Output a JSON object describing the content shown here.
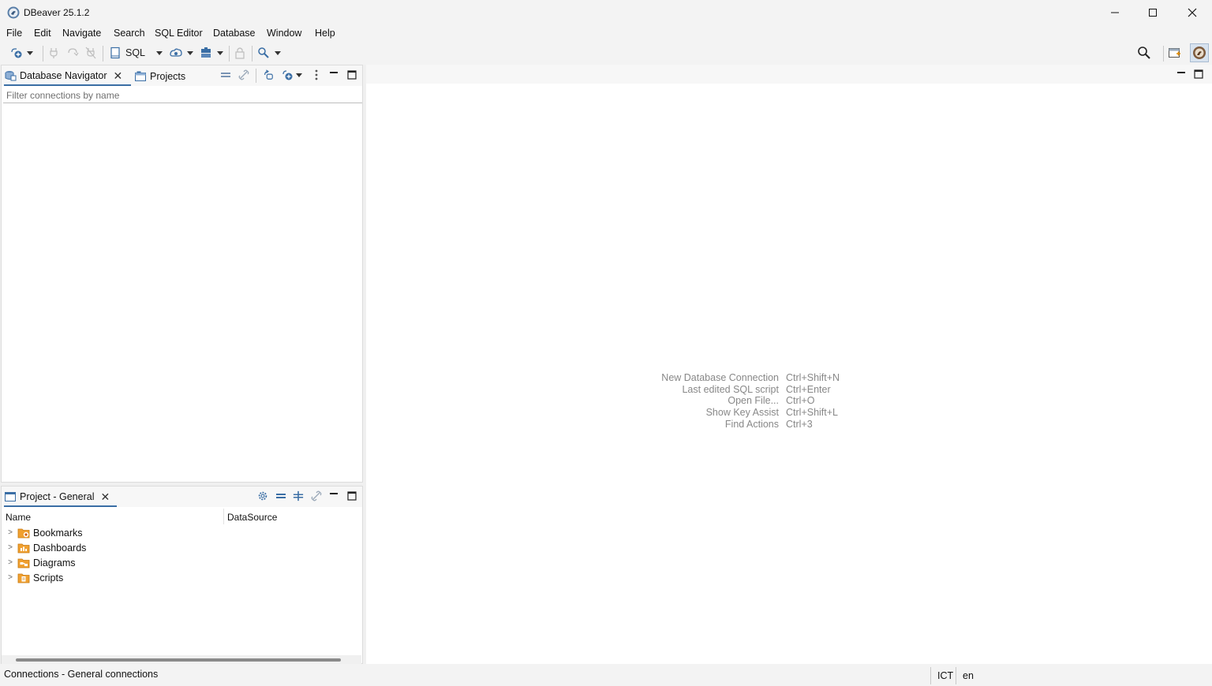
{
  "window": {
    "title": "DBeaver 25.1.2"
  },
  "menu": [
    "File",
    "Edit",
    "Navigate",
    "Search",
    "SQL Editor",
    "Database",
    "Window",
    "Help"
  ],
  "toolbar": {
    "sql_label": "SQL"
  },
  "navigator": {
    "tabs": [
      {
        "label": "Database Navigator",
        "icon": "database-navigator-icon",
        "active": true
      },
      {
        "label": "Projects",
        "icon": "projects-icon",
        "active": false
      }
    ],
    "filter_placeholder": "Filter connections by name"
  },
  "project": {
    "tab_label": "Project - General",
    "columns": [
      "Name",
      "DataSource"
    ],
    "items": [
      {
        "label": "Bookmarks",
        "icon": "bookmarks-folder-icon"
      },
      {
        "label": "Dashboards",
        "icon": "dashboards-folder-icon"
      },
      {
        "label": "Diagrams",
        "icon": "diagrams-folder-icon"
      },
      {
        "label": "Scripts",
        "icon": "scripts-folder-icon"
      }
    ]
  },
  "editor": {
    "shortcuts": [
      {
        "label": "New Database Connection",
        "key": "Ctrl+Shift+N"
      },
      {
        "label": "Last edited SQL script",
        "key": "Ctrl+Enter"
      },
      {
        "label": "Open File...",
        "key": "Ctrl+O"
      },
      {
        "label": "Show Key Assist",
        "key": "Ctrl+Shift+L"
      },
      {
        "label": "Find Actions",
        "key": "Ctrl+3"
      }
    ]
  },
  "status": {
    "text": "Connections - General connections",
    "timezone": "ICT",
    "locale": "en"
  },
  "colors": {
    "accent": "#3a6ea5",
    "folder": "#f0a030"
  }
}
